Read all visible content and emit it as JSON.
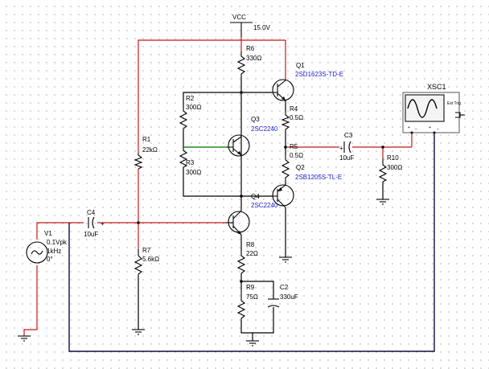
{
  "vcc": {
    "name": "VCC",
    "value": "15.0V"
  },
  "parts": {
    "q1": {
      "ref": "Q1",
      "model": "2SD1623S-TD-E"
    },
    "q2": {
      "ref": "Q2",
      "model": "2SB1205S-TL-E"
    },
    "q3": {
      "ref": "Q3",
      "model": "2SC2240"
    },
    "q4": {
      "ref": "Q4",
      "model": "2SC2240"
    },
    "r1": {
      "ref": "R1",
      "value": "22kΩ"
    },
    "r2": {
      "ref": "R2",
      "value": "300Ω"
    },
    "r3": {
      "ref": "R3",
      "value": "300Ω"
    },
    "r4": {
      "ref": "R4",
      "value": "0.5Ω"
    },
    "r5": {
      "ref": "R5",
      "value": "0.5Ω"
    },
    "r6": {
      "ref": "R6",
      "value": "330Ω"
    },
    "r7": {
      "ref": "R7",
      "value": "5.6kΩ"
    },
    "r8": {
      "ref": "R8",
      "value": "22Ω"
    },
    "r9": {
      "ref": "R9",
      "value": "75Ω"
    },
    "r10": {
      "ref": "R10",
      "value": "300Ω"
    },
    "c2": {
      "ref": "C2",
      "value": "330uF"
    },
    "c3": {
      "ref": "C3",
      "value": "10uF"
    },
    "c4": {
      "ref": "C4",
      "value": "10uF"
    },
    "v1": {
      "ref": "V1",
      "amp": "0.1Vpk",
      "freq": "1kHz",
      "phase": "0°"
    }
  },
  "scope": {
    "name": "XSC1",
    "trig": "Ext Trig"
  },
  "colors": {
    "wire_red": "#c81818",
    "wire_black": "#000000",
    "wire_green": "#1f9a1f",
    "label_blue": "#1a1ad0"
  }
}
